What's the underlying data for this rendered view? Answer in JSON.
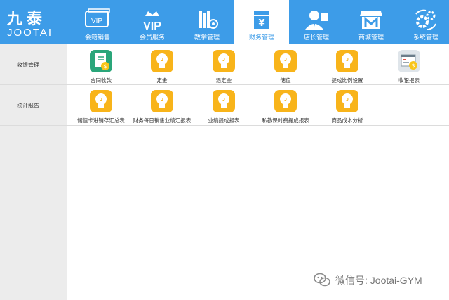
{
  "logo": {
    "cn": "九泰",
    "en": "JOOTAI"
  },
  "nav": [
    {
      "label": "会籍销售",
      "icon": "vip-card-icon"
    },
    {
      "label": "会员服务",
      "icon": "vip-crown-icon"
    },
    {
      "label": "教学管理",
      "icon": "books-gear-icon"
    },
    {
      "label": "财务管理",
      "icon": "yuan-box-icon",
      "active": true
    },
    {
      "label": "店长管理",
      "icon": "manager-icon"
    },
    {
      "label": "商城管理",
      "icon": "store-icon"
    },
    {
      "label": "系统管理",
      "icon": "gears-icon"
    }
  ],
  "sections": [
    {
      "label": "收银管理",
      "items": [
        {
          "label": "合同收款",
          "icon": "contract-payment-icon"
        },
        {
          "label": "定金",
          "icon": "lightbulb-icon"
        },
        {
          "label": "退定金",
          "icon": "lightbulb-icon"
        },
        {
          "label": "储值",
          "icon": "lightbulb-icon"
        },
        {
          "label": "提成比例设置",
          "icon": "lightbulb-icon"
        },
        {
          "label": "收银报表",
          "icon": "report-coin-icon"
        }
      ]
    },
    {
      "label": "统计报告",
      "items": [
        {
          "label": "储值卡进销存汇总表",
          "icon": "lightbulb-icon"
        },
        {
          "label": "财务每日销售业绩汇报表",
          "icon": "lightbulb-icon"
        },
        {
          "label": "业绩提成报表",
          "icon": "lightbulb-icon"
        },
        {
          "label": "私教课时费提成报表",
          "icon": "lightbulb-icon"
        },
        {
          "label": "商品成本分析",
          "icon": "lightbulb-icon"
        }
      ]
    }
  ],
  "watermark": {
    "text": "微信号: Jootai-GYM"
  },
  "colors": {
    "primary": "#3d9ce8",
    "tile_yellow": "#f8b41a",
    "tile_green": "#2aa67a",
    "sidebar": "#ececec"
  }
}
